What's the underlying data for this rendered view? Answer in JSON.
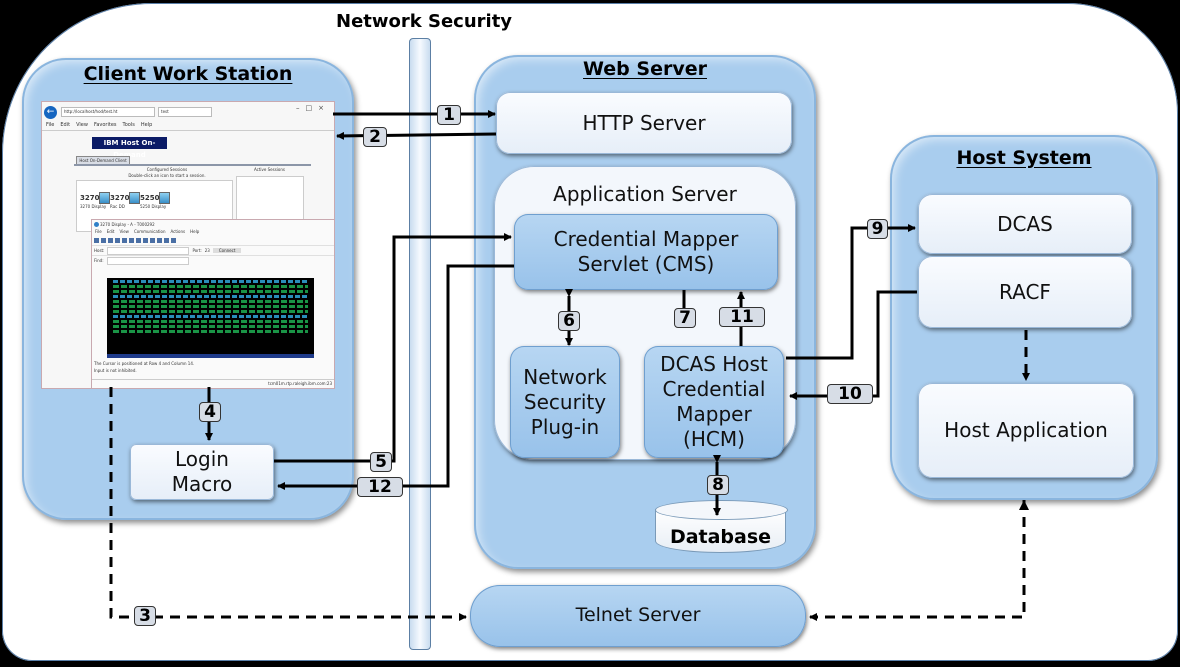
{
  "diagram_title": "Network Security",
  "panels": {
    "client": {
      "title": "Client Work Station"
    },
    "web": {
      "title": "Web Server"
    },
    "host": {
      "title": "Host System"
    }
  },
  "components": {
    "http_server": "HTTP Server",
    "app_server": "Application Server",
    "cms_line1": "Credential Mapper",
    "cms_line2": "Servlet (CMS)",
    "nsp_line1": "Network",
    "nsp_line2": "Security",
    "nsp_line3": "Plug-in",
    "hcm_line1": "DCAS Host",
    "hcm_line2": "Credential",
    "hcm_line3": "Mapper",
    "hcm_line4": "(HCM)",
    "database": "Database",
    "dcas": "DCAS",
    "racf": "RACF",
    "host_app": "Host Application",
    "telnet": "Telnet Server",
    "login_line1": "Login",
    "login_line2": "Macro"
  },
  "steps": [
    "1",
    "2",
    "3",
    "4",
    "5",
    "6",
    "7",
    "8",
    "9",
    "10",
    "11",
    "12"
  ],
  "browser": {
    "address": "http://localhost/hod/test.ht",
    "tab": "test",
    "menu": [
      "File",
      "Edit",
      "View",
      "Favorites",
      "Tools",
      "Help"
    ],
    "banner": "IBM Host On-Demand",
    "client_tab": "Host On-Demand Client",
    "configured_sessions": "Configured Sessions",
    "configured_hint": "Double-click an icon to start a session.",
    "active_sessions": "Active Sessions",
    "sessions": [
      {
        "type": "3270",
        "label": "3270 Display"
      },
      {
        "type": "3270",
        "label": "Rac DD"
      },
      {
        "type": "5250",
        "label": "5250 Display"
      }
    ]
  },
  "terminal": {
    "title": "3270 Display - A - T000292",
    "menu": [
      "File",
      "Edit",
      "View",
      "Communication",
      "Actions",
      "Help"
    ],
    "host_label": "Host:",
    "port_label": "Port:",
    "port_value": "23",
    "connect_label": "Connect",
    "find_label": "Find:",
    "status_line1": "The Cursor is positioned at Row 4 and Column 14.",
    "status_line2": "Input is not inhibited.",
    "host_address": "tcm01m.rtp.raleigh.ibm.com:23"
  },
  "colors": {
    "panel_blue": "#a9cdee",
    "box_light": "#f2f6fb",
    "box_blue": "#a6ccef",
    "banner_navy": "#0b1b66",
    "badge_gray": "#d7dde6"
  }
}
